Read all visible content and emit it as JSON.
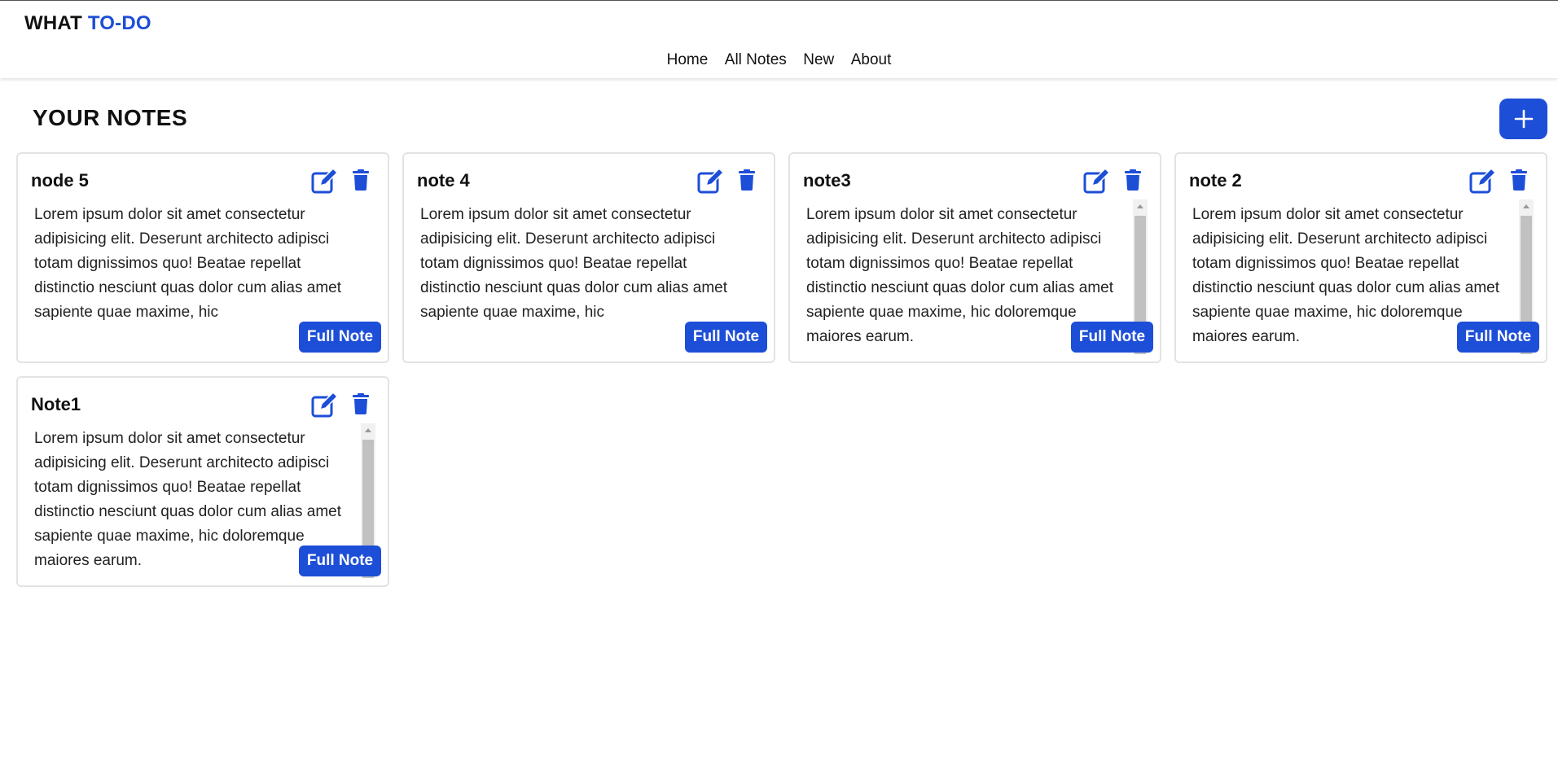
{
  "brand": {
    "part1": "WHAT",
    "part2": "TO-DO"
  },
  "nav": {
    "home": "Home",
    "all_notes": "All Notes",
    "new": "New",
    "about": "About"
  },
  "page": {
    "title": "YOUR NOTES"
  },
  "colors": {
    "accent": "#1d4ed8",
    "border": "#e3e3e3"
  },
  "icons": {
    "add": "plus-icon",
    "edit": "edit-icon",
    "delete": "trash-icon"
  },
  "notes": [
    {
      "title": "node 5",
      "body": "Lorem ipsum dolor sit amet consectetur adipisicing elit. Deserunt architecto adipisci totam dignissimos quo! Beatae repellat distinctio nesciunt quas dolor cum alias amet sapiente quae maxime, hic",
      "button": "Full Note"
    },
    {
      "title": "note 4",
      "body": "Lorem ipsum dolor sit amet consectetur adipisicing elit. Deserunt architecto adipisci totam dignissimos quo! Beatae repellat distinctio nesciunt quas dolor cum alias amet sapiente quae maxime, hic",
      "button": "Full Note"
    },
    {
      "title": "note3",
      "body": "Lorem ipsum dolor sit amet consectetur adipisicing elit. Deserunt architecto adipisci totam dignissimos quo! Beatae repellat distinctio nesciunt quas dolor cum alias amet sapiente quae maxime, hic doloremque maiores earum.",
      "button": "Full Note"
    },
    {
      "title": "note 2",
      "body": "Lorem ipsum dolor sit amet consectetur adipisicing elit. Deserunt architecto adipisci totam dignissimos quo! Beatae repellat distinctio nesciunt quas dolor cum alias amet sapiente quae maxime, hic doloremque maiores earum.",
      "button": "Full Note"
    },
    {
      "title": "Note1",
      "body": "Lorem ipsum dolor sit amet consectetur adipisicing elit. Deserunt architecto adipisci totam dignissimos quo! Beatae repellat distinctio nesciunt quas dolor cum alias amet sapiente quae maxime, hic doloremque maiores earum.",
      "button": "Full Note"
    }
  ]
}
